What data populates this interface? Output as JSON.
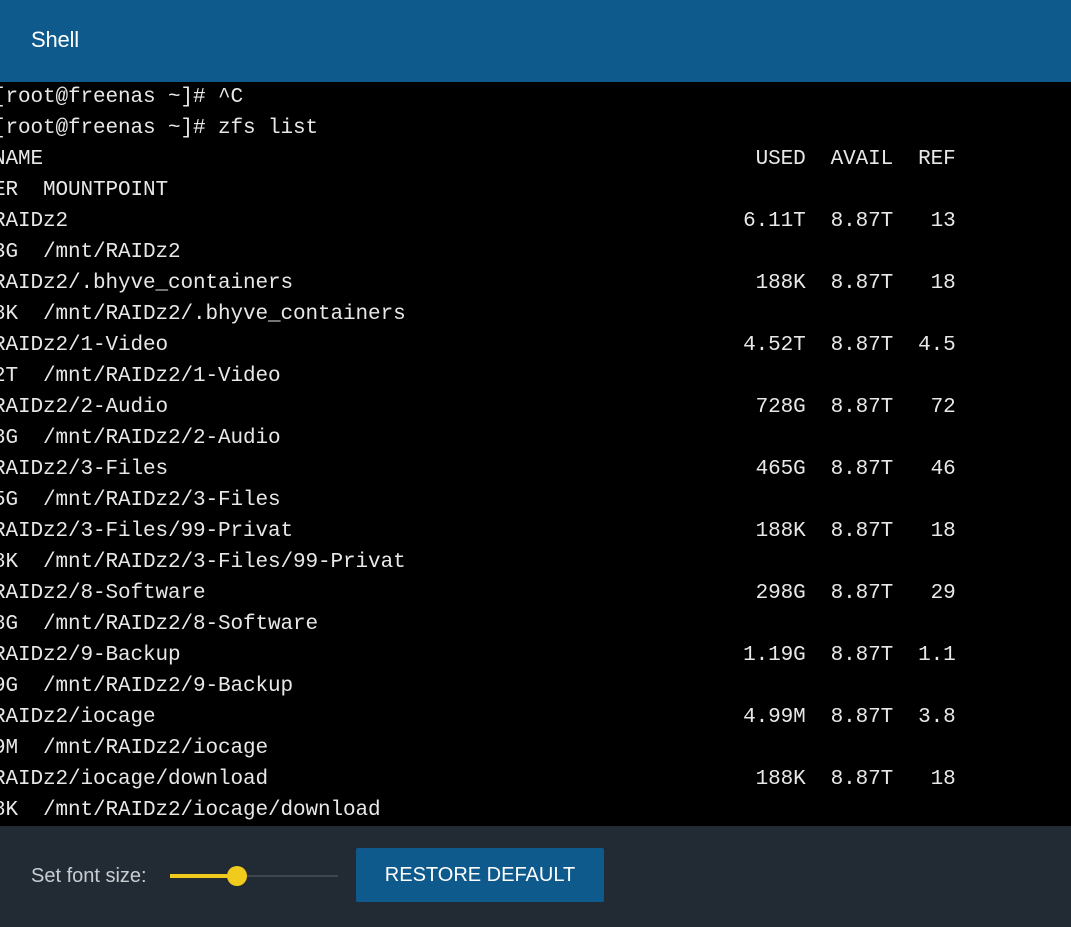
{
  "header": {
    "title": "Shell"
  },
  "terminal": {
    "lines": [
      "[root@freenas ~]# ^C",
      "[root@freenas ~]# zfs list",
      "NAME                                                         USED  AVAIL  REF",
      "ER  MOUNTPOINT",
      "RAIDz2                                                      6.11T  8.87T   13",
      "3G  /mnt/RAIDz2",
      "RAIDz2/.bhyve_containers                                     188K  8.87T   18",
      "8K  /mnt/RAIDz2/.bhyve_containers",
      "RAIDz2/1-Video                                              4.52T  8.87T  4.5",
      "2T  /mnt/RAIDz2/1-Video",
      "RAIDz2/2-Audio                                               728G  8.87T   72",
      "8G  /mnt/RAIDz2/2-Audio",
      "RAIDz2/3-Files                                               465G  8.87T   46",
      "5G  /mnt/RAIDz2/3-Files",
      "RAIDz2/3-Files/99-Privat                                     188K  8.87T   18",
      "8K  /mnt/RAIDz2/3-Files/99-Privat",
      "RAIDz2/8-Software                                            298G  8.87T   29",
      "8G  /mnt/RAIDz2/8-Software",
      "RAIDz2/9-Backup                                             1.19G  8.87T  1.1",
      "9G  /mnt/RAIDz2/9-Backup",
      "RAIDz2/iocage                                               4.99M  8.87T  3.8",
      "9M  /mnt/RAIDz2/iocage",
      "RAIDz2/iocage/download                                       188K  8.87T   18",
      "8K  /mnt/RAIDz2/iocage/download"
    ]
  },
  "footer": {
    "font_size_label": "Set font size:",
    "font_size_slider": {
      "fraction": 0.4
    },
    "restore_label": "RESTORE DEFAULT"
  },
  "colors": {
    "header_bg": "#0f5a8d",
    "terminal_bg": "#000000",
    "terminal_fg": "#e8e8e8",
    "footer_bg": "#222b34",
    "slider_accent": "#f0cb1e",
    "button_bg": "#0f5a8d"
  }
}
